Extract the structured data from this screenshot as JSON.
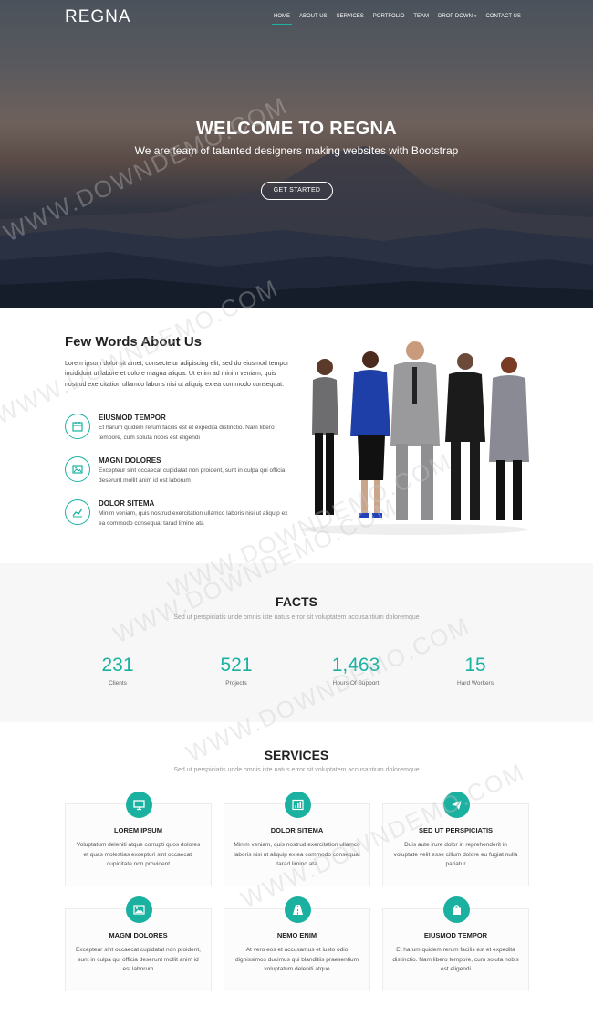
{
  "brand": {
    "logo": "REGNA",
    "accent": "#1bb1a1"
  },
  "nav": {
    "items": [
      {
        "label": "HOME",
        "active": true
      },
      {
        "label": "ABOUT US"
      },
      {
        "label": "SERVICES"
      },
      {
        "label": "PORTFOLIO"
      },
      {
        "label": "TEAM"
      },
      {
        "label": "DROP DOWN",
        "has_caret": true
      },
      {
        "label": "CONTACT US"
      }
    ]
  },
  "hero": {
    "title": "WELCOME TO REGNA",
    "subtitle": "We are team of talanted designers making websites with Bootstrap",
    "cta": "GET STARTED"
  },
  "about": {
    "title": "Few Words About Us",
    "text": "Lorem ipsum dolor sit amet, consectetur adipiscing elit, sed do eiusmod tempor incididunt ut labore et dolore magna aliqua. Ut enim ad minim veniam, quis nostrud exercitation ullamco laboris nisi ut aliquip ex ea commodo consequat.",
    "features": [
      {
        "icon": "calendar-icon",
        "title": "EIUSMOD TEMPOR",
        "desc": "Et harum quidem rerum facilis est et expedita distinctio. Nam libero tempore, cum soluta nobis est eligendi"
      },
      {
        "icon": "image-icon",
        "title": "MAGNI DOLORES",
        "desc": "Excepteur sint occaecat cupidatat non proident, sunt in culpa qui officia deserunt mollit anim id est laborum"
      },
      {
        "icon": "chart-icon",
        "title": "DOLOR SITEMA",
        "desc": "Minim veniam, quis nostrud exercitation ullamco laboris nisi ut aliquip ex ea commodo consequat tarad limino ata"
      }
    ]
  },
  "facts": {
    "title": "FACTS",
    "subtitle": "Sed ut perspiciatis unde omnis iste natus error sit voluptatem accusantium doloremque",
    "stats": [
      {
        "value": "231",
        "label": "Clients"
      },
      {
        "value": "521",
        "label": "Projects"
      },
      {
        "value": "1,463",
        "label": "Hours Of Support"
      },
      {
        "value": "15",
        "label": "Hard Workers"
      }
    ]
  },
  "services": {
    "title": "SERVICES",
    "subtitle": "Sed ut perspiciatis unde omnis iste natus error sit voluptatem accusantium doloremque",
    "cards": [
      {
        "icon": "desktop-icon",
        "title": "LOREM IPSUM",
        "desc": "Voluptatum deleniti atque corrupti quos dolores et quas molestias excepturi sint occaecati cupiditate non provident"
      },
      {
        "icon": "bar-chart-icon",
        "title": "DOLOR SITEMA",
        "desc": "Minim veniam, quis nostrud exercitation ullamco laboris nisi ut aliquip ex ea commodo consequat tarad limino ata"
      },
      {
        "icon": "paper-plane-icon",
        "title": "SED UT PERSPICIATIS",
        "desc": "Duis aute irure dolor in reprehenderit in voluptate velit esse cillum dolore eu fugiat nulla pariatur"
      },
      {
        "icon": "image-icon",
        "title": "MAGNI DOLORES",
        "desc": "Excepteur sint occaecat cupidatat non proident, sunt in culpa qui officia deserunt mollit anim id est laborum"
      },
      {
        "icon": "road-icon",
        "title": "NEMO ENIM",
        "desc": "At vero eos et accusamus et iusto odio dignissimos ducimus qui blanditiis praesentium voluptatum deleniti atque"
      },
      {
        "icon": "shopping-bag-icon",
        "title": "EIUSMOD TEMPOR",
        "desc": "Et harum quidem rerum facilis est et expedita distinctio. Nam libero tempore, cum soluta nobis est eligendi"
      }
    ]
  },
  "watermark": "WWW.DOWNDEMO.COM"
}
